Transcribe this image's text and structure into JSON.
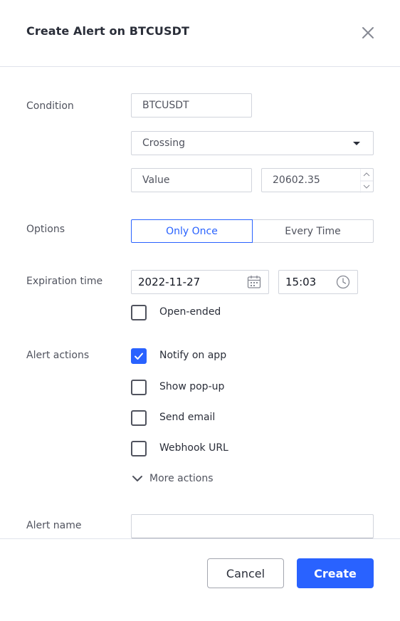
{
  "dialog": {
    "title": "Create Alert on BTCUSDT"
  },
  "condition": {
    "label": "Condition",
    "symbol": "BTCUSDT",
    "operator": "Crossing",
    "value_type": "Value",
    "value": "20602.35"
  },
  "options": {
    "label": "Options",
    "only_once": "Only Once",
    "every_time": "Every Time",
    "selected": "Only Once"
  },
  "expiration": {
    "label": "Expiration time",
    "date": "2022-11-27",
    "time": "15:03",
    "open_ended_label": "Open-ended",
    "open_ended_checked": false
  },
  "alert_actions": {
    "label": "Alert actions",
    "items": [
      {
        "label": "Notify on app",
        "checked": true
      },
      {
        "label": "Show pop-up",
        "checked": false
      },
      {
        "label": "Send email",
        "checked": false
      },
      {
        "label": "Webhook URL",
        "checked": false
      }
    ],
    "more_actions": "More actions"
  },
  "alert_name": {
    "label": "Alert name",
    "value": ""
  },
  "footer": {
    "cancel_label": "Cancel",
    "create_label": "Create"
  },
  "colors": {
    "accent": "#2962ff",
    "text": "#2a2e39",
    "muted": "#50535e",
    "border": "#d1d4dc"
  }
}
